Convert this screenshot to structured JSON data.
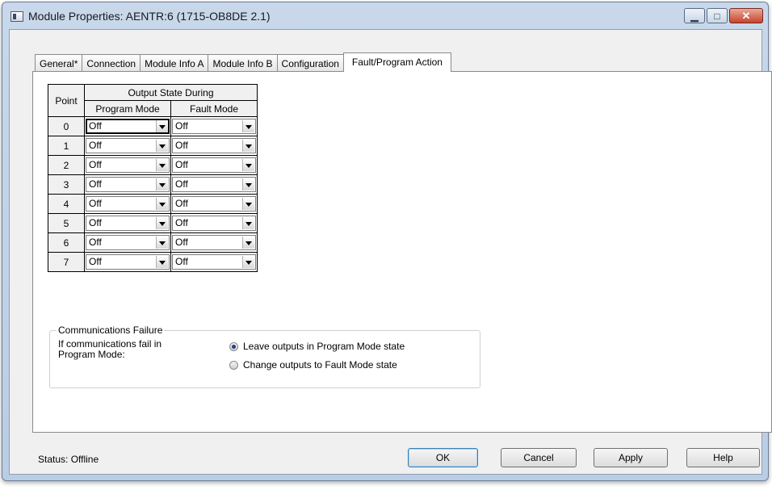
{
  "window": {
    "title": "Module Properties: AENTR:6 (1715-OB8DE 2.1)",
    "controls": {
      "minimize": "▁",
      "maximize": "□",
      "close": "✕"
    }
  },
  "tabs": [
    {
      "label": "General*"
    },
    {
      "label": "Connection"
    },
    {
      "label": "Module Info A"
    },
    {
      "label": "Module Info B"
    },
    {
      "label": "Configuration"
    },
    {
      "label": "Fault/Program Action",
      "active": true
    }
  ],
  "grid": {
    "point_header": "Point",
    "group_header": "Output State During",
    "program_header": "Program Mode",
    "fault_header": "Fault Mode",
    "rows": [
      {
        "point": "0",
        "program": "Off",
        "fault": "Off"
      },
      {
        "point": "1",
        "program": "Off",
        "fault": "Off"
      },
      {
        "point": "2",
        "program": "Off",
        "fault": "Off"
      },
      {
        "point": "3",
        "program": "Off",
        "fault": "Off"
      },
      {
        "point": "4",
        "program": "Off",
        "fault": "Off"
      },
      {
        "point": "5",
        "program": "Off",
        "fault": "Off"
      },
      {
        "point": "6",
        "program": "Off",
        "fault": "Off"
      },
      {
        "point": "7",
        "program": "Off",
        "fault": "Off"
      }
    ]
  },
  "comm_failure": {
    "legend": "Communications Failure",
    "description": "If communications fail in Program Mode:",
    "options": [
      {
        "label": "Leave outputs in Program Mode state",
        "selected": true
      },
      {
        "label": "Change outputs to Fault Mode state",
        "selected": false
      }
    ]
  },
  "footer": {
    "status": "Status:  Offline",
    "ok": "OK",
    "cancel": "Cancel",
    "apply": "Apply",
    "help": "Help"
  },
  "colors": {
    "title_bar": "#c8d8ea",
    "close_button": "#c7432c",
    "dialog_bg": "#f0f0f0"
  }
}
